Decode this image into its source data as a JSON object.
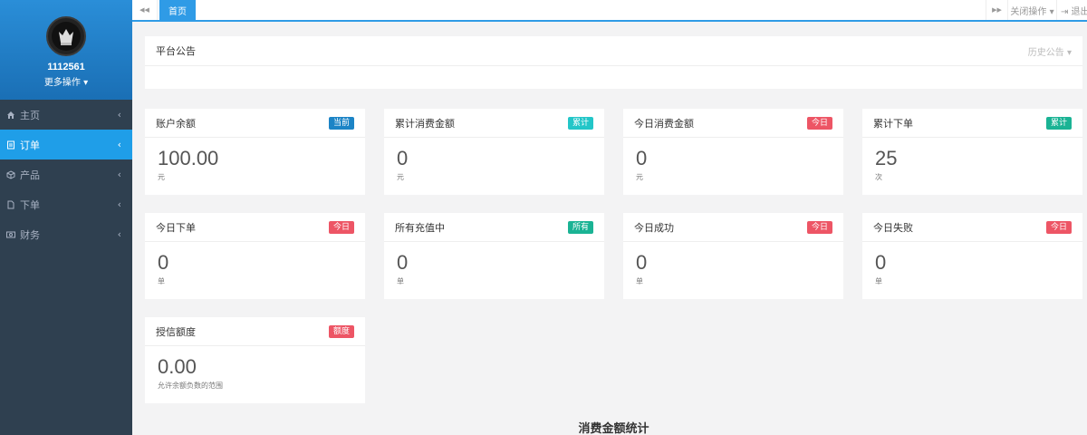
{
  "colors": {
    "sidebar": "#2f4050",
    "accent": "#1f9ee8",
    "blue": "#1c84c6",
    "cyan": "#23c6c8",
    "red": "#ed5565",
    "green": "#1ab394"
  },
  "profile": {
    "user_id": "1112561",
    "more_label": "更多操作 ▾"
  },
  "sidebar": {
    "items": [
      {
        "label": "主页",
        "icon": "home-icon",
        "arrow": "‹"
      },
      {
        "label": "订单",
        "icon": "document-icon",
        "arrow": "‹"
      },
      {
        "label": "产品",
        "icon": "cube-icon",
        "arrow": "‹"
      },
      {
        "label": "下单",
        "icon": "file-icon",
        "arrow": "‹"
      },
      {
        "label": "财务",
        "icon": "money-icon",
        "arrow": "‹"
      }
    ]
  },
  "topbar": {
    "back": "◀◀",
    "home_tab": "首页",
    "forward": "▶▶",
    "close_ops": "关闭操作 ▾",
    "exit": "⇥ 退出"
  },
  "notice": {
    "title": "平台公告",
    "history": "历史公告 ▾"
  },
  "cards": [
    {
      "title": "账户余额",
      "badge": "当前",
      "value": "100.00",
      "unit": "元"
    },
    {
      "title": "累计消费金额",
      "badge": "累计",
      "value": "0",
      "unit": "元"
    },
    {
      "title": "今日消费金额",
      "badge": "今日",
      "value": "0",
      "unit": "元"
    },
    {
      "title": "累计下单",
      "badge": "累计",
      "value": "25",
      "unit": "次"
    },
    {
      "title": "今日下单",
      "badge": "今日",
      "value": "0",
      "unit": "单"
    },
    {
      "title": "所有充值中",
      "badge": "所有",
      "value": "0",
      "unit": "单"
    },
    {
      "title": "今日成功",
      "badge": "今日",
      "value": "0",
      "unit": "单"
    },
    {
      "title": "今日失败",
      "badge": "今日",
      "value": "0",
      "unit": "单"
    },
    {
      "title": "授信额度",
      "badge": "额度",
      "value": "0.00",
      "unit": "允许余额负数的范围"
    }
  ],
  "stats_title": "消费金额统计"
}
